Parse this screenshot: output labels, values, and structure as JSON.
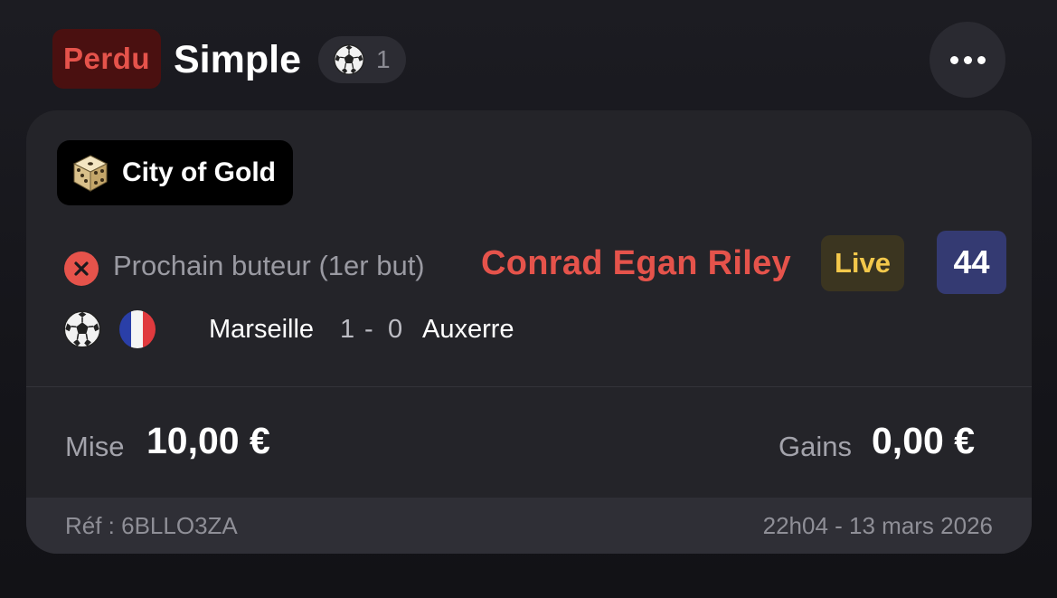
{
  "header": {
    "status": "Perdu",
    "bet_type": "Simple",
    "sport_icon": "soccer-ball-icon",
    "selection_count": "1",
    "more_icon": "more-horizontal-icon"
  },
  "card": {
    "game_tag": {
      "icon": "dice-icon",
      "name": "City of Gold"
    },
    "selection": {
      "result_icon": "lost-x-icon",
      "market": "Prochain buteur (1er but)",
      "pick": "Conrad Egan Riley",
      "live_label": "Live",
      "minute": "44"
    },
    "match": {
      "sport_icon": "soccer-ball-icon",
      "flag_icon": "france-flag-icon",
      "home_team": "Marseille",
      "home_score": "1",
      "separator": "-",
      "away_score": "0",
      "away_team": "Auxerre"
    },
    "stake": {
      "label": "Mise",
      "value": "10,00 €"
    },
    "gains": {
      "label": "Gains",
      "value": "0,00 €"
    },
    "footer": {
      "ref": "Réf : 6BLLO3ZA",
      "date": "22h04 - 13 mars 2026"
    }
  },
  "colors": {
    "lost_red": "#e5534b",
    "live_yellow": "#f3c84b",
    "minute_blue": "#343a72",
    "card_bg": "#242429"
  }
}
